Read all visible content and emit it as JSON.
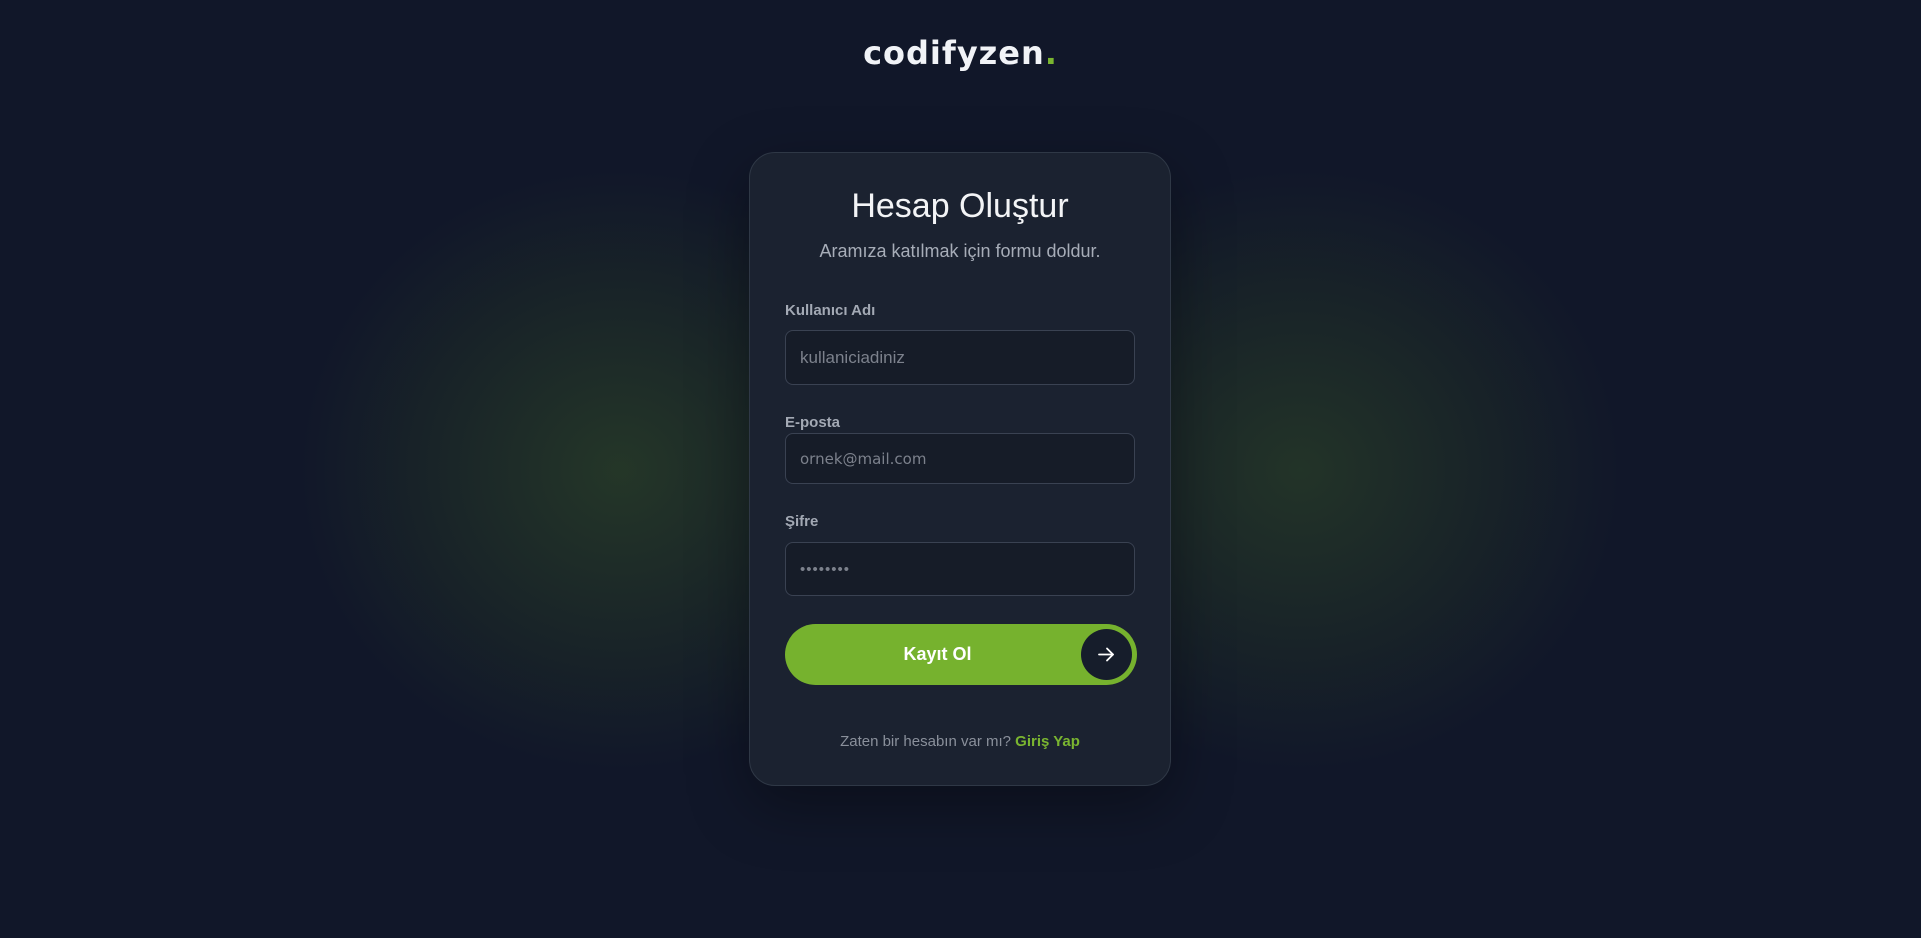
{
  "brand": {
    "name": "codifyzen",
    "dot": ".",
    "accent_color": "#7ab530"
  },
  "form": {
    "title": "Hesap Oluştur",
    "subtitle": "Aramıza katılmak için formu doldur.",
    "fields": {
      "username": {
        "label": "Kullanıcı Adı",
        "placeholder": "kullaniciadiniz",
        "value": ""
      },
      "email": {
        "label": "E-posta",
        "placeholder": "ornek@mail.com",
        "value": ""
      },
      "password": {
        "label": "Şifre",
        "placeholder": "••••••••",
        "value": ""
      }
    },
    "submit_label": "Kayıt Ol",
    "submit_icon": "arrow-right-icon"
  },
  "footer": {
    "prompt": "Zaten bir hesabın var mı?",
    "link_label": "Giriş Yap"
  },
  "colors": {
    "background": "#111729",
    "card": "#1b2230",
    "accent": "#76b22e"
  }
}
